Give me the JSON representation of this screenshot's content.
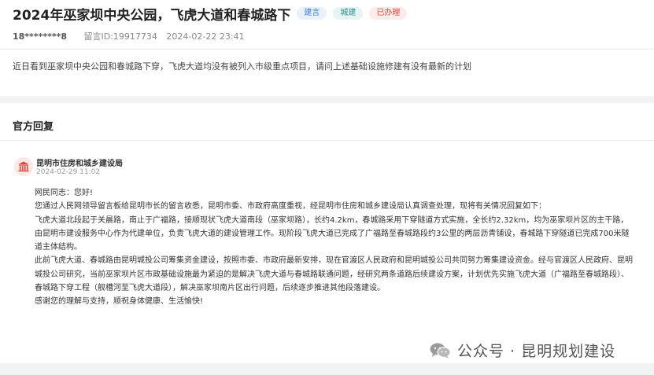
{
  "post": {
    "title": "2024年巫家坝中央公园，飞虎大道和春城路下",
    "tags": [
      {
        "label": "建言",
        "color": "#3b7dd8"
      },
      {
        "label": "城建",
        "color": "#2f8f8f"
      },
      {
        "label": "已办理",
        "color": "#e0443a"
      }
    ],
    "user": "18********8",
    "message_id": "留言ID:19917734",
    "time": "2024-02-22 23:41",
    "content": "近日看到巫家坝中央公园和春城路下穿，飞虎大道均没有被列入市级重点项目，请问上述基础设施修建有没有最新的计划"
  },
  "reply": {
    "section_title": "官方回复",
    "department": "昆明市住房和城乡建设局",
    "time": "2024-02-29 11:02",
    "avatar_icon": "government-building-icon",
    "lines": [
      "网民同志：您好!",
      "您通过人民网领导留言板给昆明市长的留言收悉，昆明市委、市政府高度重视，经昆明市住房和城乡建设局认真调查处理，现将有关情况回复如下：",
      "飞虎大道北段起于关晨路，南止于广福路，接顺现状飞虎大道南段（巫家坝路），长约4.2km，春城路采用下穿隧道方式实施，全长约2.32km，均为巫家坝片区的主干路，",
      "由昆明市建设服务中心作为代建单位，负责飞虎大道的建设管理工作。现阶段飞虎大道已完成了广福路至春城路段约3公里的两层沥青铺设，春城路下穿隧道已完成700米隧",
      "道主体结构。",
      "此前飞虎大道、春城路由昆明城投公司筹集资金建设，按照市委、市政府最新安排，现在官渡区人民政府和昆明城投公司共同努力筹集建设资金。经与官渡区人民政府、昆明",
      "城投公司研究，当前巫家坝片区市政基础设施最为紧迫的是解决飞虎大道与春城路联通问题，经研究两条道路后续建设方案，计划优先实施飞虎大道（广福路至春城路段）、",
      "春城路下穿工程（舰槽河至飞虎大道段），解决巫家坝南片区出行问题，后续逐步推进其他段落建设。",
      "感谢您的理解与支持，顺祝身体健康、生活愉快!"
    ]
  },
  "watermark": {
    "text": "公众号 · 昆明规划建设",
    "icon": "wechat-icon"
  }
}
